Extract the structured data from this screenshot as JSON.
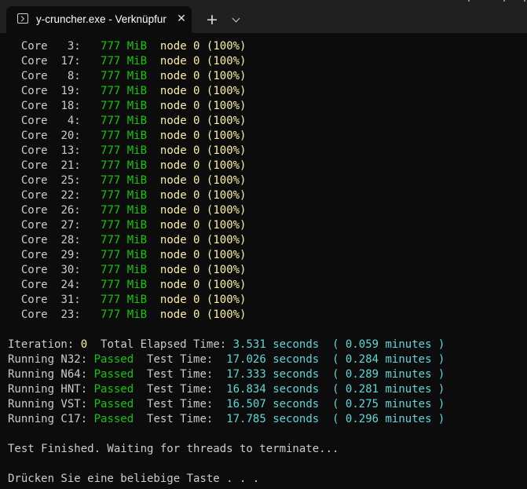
{
  "window": {
    "tab_title": "y-cruncher.exe - Verknüpfung",
    "tab_close_glyph": "✕",
    "new_tab_glyph": "+"
  },
  "colors": {
    "background": "#0c0c0c",
    "titlebar": "#202020",
    "text_default": "#cccccc",
    "text_green": "#16c60c",
    "text_yellow": "#f9f1a5",
    "text_cyan": "#61d6d6"
  },
  "icons": {
    "terminal": "terminal-icon",
    "close": "close-icon",
    "add": "plus-icon",
    "dropdown": "chevron-down-icon"
  },
  "terminal": {
    "cores": [
      {
        "label": "Core",
        "id": "3:",
        "memory": "777 MiB",
        "node": "node 0 (100%)"
      },
      {
        "label": "Core",
        "id": "17:",
        "memory": "777 MiB",
        "node": "node 0 (100%)"
      },
      {
        "label": "Core",
        "id": "8:",
        "memory": "777 MiB",
        "node": "node 0 (100%)"
      },
      {
        "label": "Core",
        "id": "19:",
        "memory": "777 MiB",
        "node": "node 0 (100%)"
      },
      {
        "label": "Core",
        "id": "18:",
        "memory": "777 MiB",
        "node": "node 0 (100%)"
      },
      {
        "label": "Core",
        "id": "4:",
        "memory": "777 MiB",
        "node": "node 0 (100%)"
      },
      {
        "label": "Core",
        "id": "20:",
        "memory": "777 MiB",
        "node": "node 0 (100%)"
      },
      {
        "label": "Core",
        "id": "13:",
        "memory": "777 MiB",
        "node": "node 0 (100%)"
      },
      {
        "label": "Core",
        "id": "21:",
        "memory": "777 MiB",
        "node": "node 0 (100%)"
      },
      {
        "label": "Core",
        "id": "25:",
        "memory": "777 MiB",
        "node": "node 0 (100%)"
      },
      {
        "label": "Core",
        "id": "22:",
        "memory": "777 MiB",
        "node": "node 0 (100%)"
      },
      {
        "label": "Core",
        "id": "26:",
        "memory": "777 MiB",
        "node": "node 0 (100%)"
      },
      {
        "label": "Core",
        "id": "27:",
        "memory": "777 MiB",
        "node": "node 0 (100%)"
      },
      {
        "label": "Core",
        "id": "28:",
        "memory": "777 MiB",
        "node": "node 0 (100%)"
      },
      {
        "label": "Core",
        "id": "29:",
        "memory": "777 MiB",
        "node": "node 0 (100%)"
      },
      {
        "label": "Core",
        "id": "30:",
        "memory": "777 MiB",
        "node": "node 0 (100%)"
      },
      {
        "label": "Core",
        "id": "24:",
        "memory": "777 MiB",
        "node": "node 0 (100%)"
      },
      {
        "label": "Core",
        "id": "31:",
        "memory": "777 MiB",
        "node": "node 0 (100%)"
      },
      {
        "label": "Core",
        "id": "23:",
        "memory": "777 MiB",
        "node": "node 0 (100%)"
      }
    ],
    "iteration": {
      "label": "Iteration:",
      "value": "0",
      "elapsed_label": "Total Elapsed Time:",
      "seconds": "3.531 seconds",
      "minutes": "( 0.059 minutes )"
    },
    "tests": [
      {
        "label": "Running N32:",
        "status": "Passed",
        "time_label": "Test Time:",
        "seconds": "17.026 seconds",
        "minutes": "( 0.284 minutes )"
      },
      {
        "label": "Running N64:",
        "status": "Passed",
        "time_label": "Test Time:",
        "seconds": "17.333 seconds",
        "minutes": "( 0.289 minutes )"
      },
      {
        "label": "Running HNT:",
        "status": "Passed",
        "time_label": "Test Time:",
        "seconds": "16.834 seconds",
        "minutes": "( 0.281 minutes )"
      },
      {
        "label": "Running VST:",
        "status": "Passed",
        "time_label": "Test Time:",
        "seconds": "16.507 seconds",
        "minutes": "( 0.275 minutes )"
      },
      {
        "label": "Running C17:",
        "status": "Passed",
        "time_label": "Test Time:",
        "seconds": "17.785 seconds",
        "minutes": "( 0.296 minutes )"
      }
    ],
    "finished_message": "Test Finished. Waiting for threads to terminate...",
    "press_key_message": "Drücken Sie eine beliebige Taste . . ."
  }
}
